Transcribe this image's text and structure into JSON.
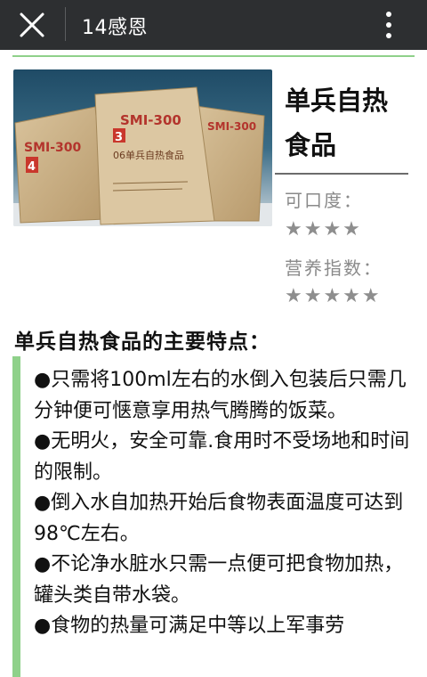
{
  "topbar": {
    "title": "14感恩",
    "close_icon": "close-icon",
    "menu_icon": "more-vertical-icon"
  },
  "product": {
    "name": "单兵自热食品",
    "taste_label": "可口度：",
    "taste_stars": "★★★★",
    "nutrition_label": "营养指数：",
    "nutrition_stars": "★★★★★",
    "image": {
      "pack_labels": [
        "SMI-300",
        "SMI-300",
        "SMI-300"
      ],
      "pack_numbers": [
        "4",
        "3"
      ],
      "pack_sublabel": "06单兵自热食品"
    }
  },
  "section": {
    "title": "单兵自热食品的主要特点：",
    "points": [
      "●只需将100ml左右的水倒入包装后只需几分钟便可惬意享用热气腾腾的饭菜。",
      "●无明火，安全可靠.食用时不受场地和时间的限制。",
      "●倒入水自加热开始后食物表面温度可达到98℃左右。",
      "●不论净水脏水只需一点便可把食物加热，罐头类自带水袋。",
      "●食物的热量可满足中等以上军事劳"
    ]
  },
  "colors": {
    "accent_green": "#8fd18a",
    "topbar": "#2d2f31"
  }
}
